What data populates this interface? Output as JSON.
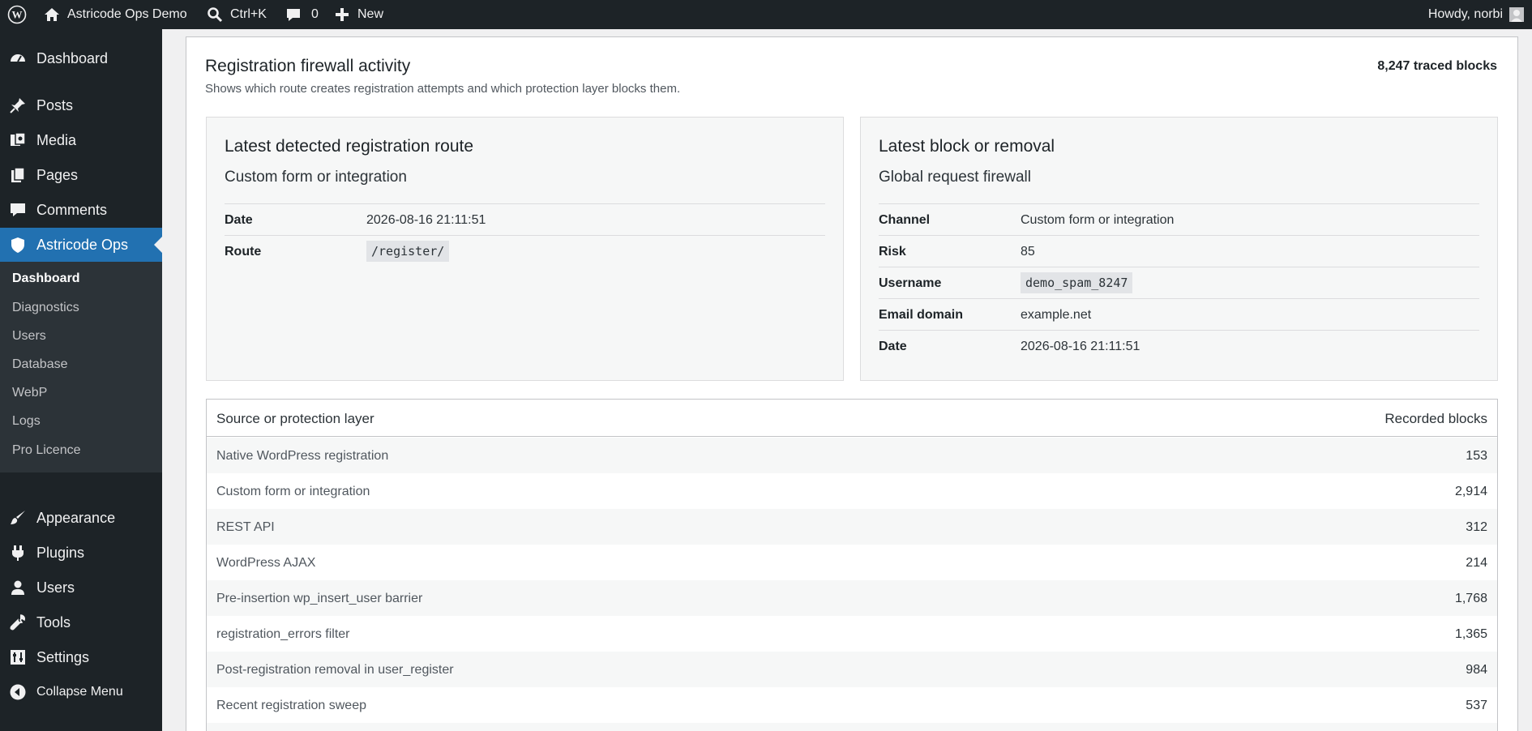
{
  "adminbar": {
    "site_name": "Astricode Ops Demo",
    "search_shortcut": "Ctrl+K",
    "comments_count": "0",
    "new_label": "New",
    "howdy": "Howdy, norbi"
  },
  "sidebar": {
    "dashboard": "Dashboard",
    "posts": "Posts",
    "media": "Media",
    "pages": "Pages",
    "comments": "Comments",
    "astricode_ops": "Astricode Ops",
    "submenu": [
      "Dashboard",
      "Diagnostics",
      "Users",
      "Database",
      "WebP",
      "Logs",
      "Pro Licence"
    ],
    "appearance": "Appearance",
    "plugins": "Plugins",
    "users": "Users",
    "tools": "Tools",
    "settings": "Settings",
    "collapse": "Collapse Menu"
  },
  "main": {
    "title": "Registration firewall activity",
    "subtitle": "Shows which route creates registration attempts and which protection layer blocks them.",
    "traced": "8,247 traced blocks",
    "route_card": {
      "title": "Latest detected registration route",
      "subtitle": "Custom form or integration",
      "rows": [
        {
          "key": "Date",
          "value": "2026-08-16 21:11:51"
        },
        {
          "key": "Route",
          "value": "/register/"
        }
      ]
    },
    "block_card": {
      "title": "Latest block or removal",
      "subtitle": "Global request firewall",
      "rows": [
        {
          "key": "Channel",
          "value": "Custom form or integration"
        },
        {
          "key": "Risk",
          "value": "85"
        },
        {
          "key": "Username",
          "value": "demo_spam_8247"
        },
        {
          "key": "Email domain",
          "value": "example.net"
        },
        {
          "key": "Date",
          "value": "2026-08-16 21:11:51"
        }
      ]
    },
    "table": {
      "header_source": "Source or protection layer",
      "header_blocks": "Recorded blocks",
      "rows": [
        {
          "source": "Native WordPress registration",
          "blocks": "153"
        },
        {
          "source": "Custom form or integration",
          "blocks": "2,914"
        },
        {
          "source": "REST API",
          "blocks": "312"
        },
        {
          "source": "WordPress AJAX",
          "blocks": "214"
        },
        {
          "source": "Pre-insertion wp_insert_user barrier",
          "blocks": "1,768"
        },
        {
          "source": "registration_errors filter",
          "blocks": "1,365"
        },
        {
          "source": "Post-registration removal in user_register",
          "blocks": "984"
        },
        {
          "source": "Recent registration sweep",
          "blocks": "537"
        }
      ]
    }
  }
}
